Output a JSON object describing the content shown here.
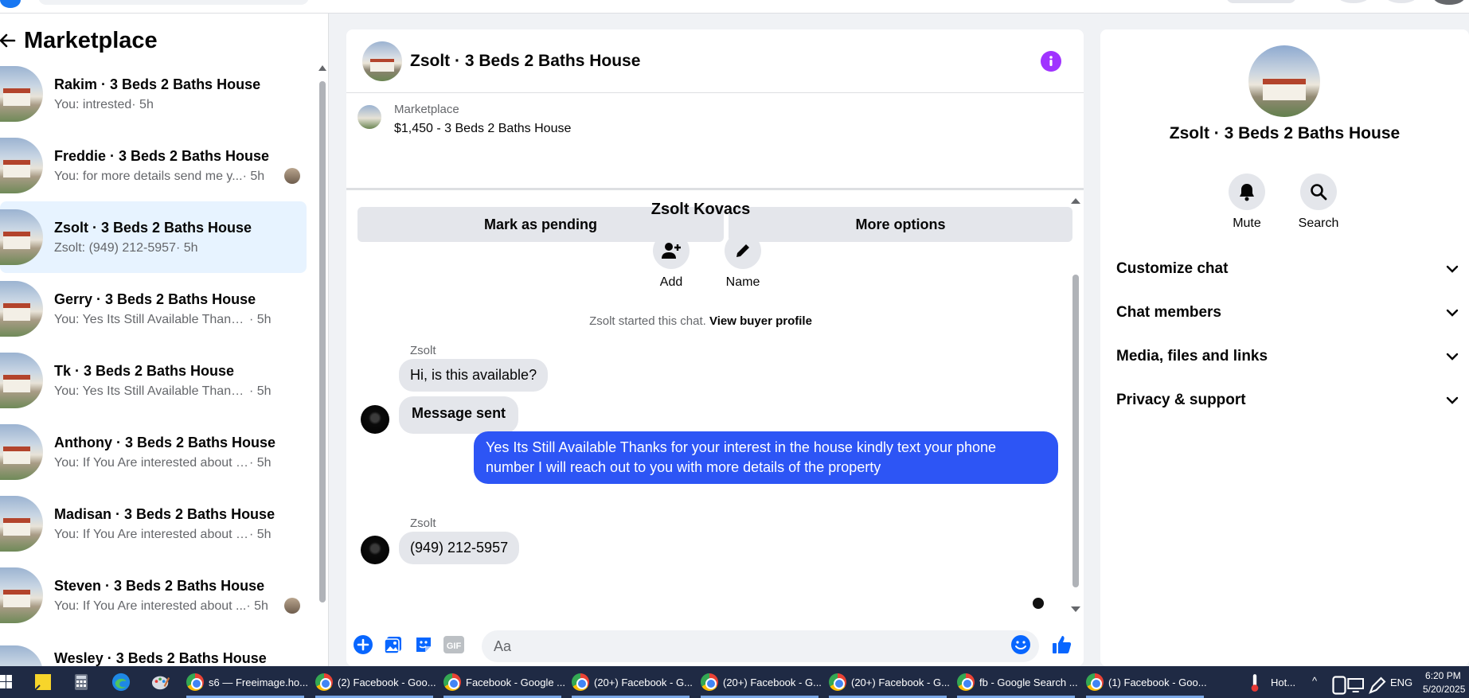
{
  "sidebar": {
    "title": "Marketplace",
    "conversations": [
      {
        "name": "Rakim · 3 Beds 2 Baths House",
        "snippet": "You: intrested",
        "time": "· 5h"
      },
      {
        "name": "Freddie · 3 Beds 2 Baths House",
        "snippet": "You: for more details send me y...",
        "time": "· 5h"
      },
      {
        "name": "Zsolt · 3 Beds 2 Baths House",
        "snippet": "Zsolt: (949) 212-5957",
        "time": "· 5h"
      },
      {
        "name": "Gerry · 3 Beds 2 Baths House",
        "snippet": "You: Yes Its Still Available Thanks fo...",
        "time": "· 5h"
      },
      {
        "name": "Tk · 3 Beds 2 Baths House",
        "snippet": "You: Yes Its Still Available Thanks fo...",
        "time": "· 5h"
      },
      {
        "name": "Anthony · 3 Beds 2 Baths House",
        "snippet": "You: If You Are interested about thi...",
        "time": "· 5h"
      },
      {
        "name": "Madisan · 3 Beds 2 Baths House",
        "snippet": "You: If You Are interested about thi...",
        "time": "· 5h"
      },
      {
        "name": "Steven · 3 Beds 2 Baths House",
        "snippet": "You: If You Are interested about ...",
        "time": "· 5h"
      },
      {
        "name": "Wesley · 3 Beds 2 Baths House",
        "snippet": "",
        "time": ""
      }
    ]
  },
  "chat": {
    "title": "Zsolt · 3 Beds 2 Baths House",
    "listing_label": "Marketplace",
    "listing_price": "$1,450 - 3 Beds 2 Baths House",
    "pending_label": "Mark as pending",
    "more_label": "More options",
    "seller_name": "Zsolt Kovacs",
    "add_label": "Add",
    "name_label": "Name",
    "started_text": "Zsolt started this chat.",
    "buyer_profile_link": "View buyer profile",
    "messages": [
      {
        "sender": "Zsolt",
        "text": "Hi, is this available?"
      },
      {
        "sender": "",
        "text": "Message sent"
      },
      {
        "sender": "You",
        "text": "Yes Its Still Available Thanks for your interest in the house kindly text your phone number I will reach out to you with more details of the property"
      },
      {
        "sender": "Zsolt",
        "text": "(949) 212-5957"
      }
    ],
    "input_placeholder": "Aa"
  },
  "details": {
    "name": "Zsolt · 3 Beds 2 Baths House",
    "mute_label": "Mute",
    "search_label": "Search",
    "sections": [
      "Customize chat",
      "Chat members",
      "Media, files and links",
      "Privacy & support"
    ]
  },
  "taskbar": {
    "items": [
      "s6 — Freeimage.ho...",
      "(2) Facebook - Goo...",
      "Facebook - Google ...",
      "(20+) Facebook - G...",
      "(20+) Facebook - G...",
      "(20+) Facebook - G...",
      "fb - Google Search ...",
      "(1) Facebook - Goo..."
    ],
    "weather": "Hot...",
    "lang": "ENG",
    "time": "6:20 PM",
    "date": "5/20/2025"
  },
  "colors": {
    "accent": "#2d55f5",
    "info": "#a033ff",
    "like": "#0866ff",
    "active_row": "#e7f3ff"
  }
}
